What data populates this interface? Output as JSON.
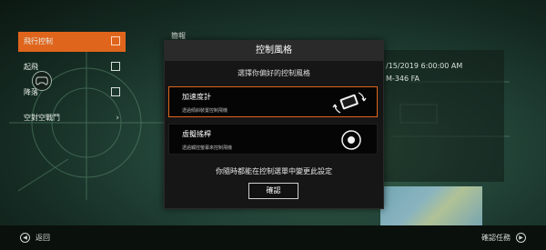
{
  "menu": {
    "items": [
      {
        "label": "飛行控制",
        "active": true
      },
      {
        "label": "起飛"
      },
      {
        "label": "降落"
      },
      {
        "label": "空對空戰鬥"
      }
    ]
  },
  "summary_label": "簡報",
  "info": {
    "date": "/15/2019 6:00:00 AM",
    "code": "M-346 FA"
  },
  "modal": {
    "title": "控制風格",
    "subtitle": "選擇你偏好的控制風格",
    "options": [
      {
        "title": "加速度計",
        "desc": "透過傾斜裝置控制飛機",
        "icon": "tilt-device-icon",
        "selected": true
      },
      {
        "title": "虛擬搖桿",
        "desc": "透過觸控螢幕來控制飛機",
        "icon": "virtual-joystick-icon",
        "selected": false
      }
    ],
    "hint": "你隨時都能在控制選單中變更此設定",
    "confirm_label": "確認"
  },
  "bottom": {
    "back_label": "返回",
    "confirm_mission_label": "確認任務"
  },
  "colors": {
    "accent": "#e0651c",
    "modal_bg": "#161616",
    "modal_header": "#2a2a2a"
  }
}
